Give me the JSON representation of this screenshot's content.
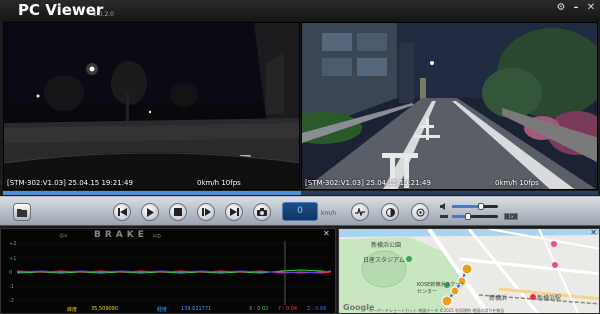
{
  "app": {
    "title": "PC Viewer",
    "version": "2.0.2.0",
    "window_buttons": {
      "settings": "⚙",
      "minimize": "–",
      "close": "✕"
    }
  },
  "video_left": {
    "osd_left": "[STM-302:V1.03] 25.04.15 19:21:49",
    "osd_right": "0km/h  10fps"
  },
  "video_right": {
    "osd_left": "[STM-302:V1.03] 25.04.15 19:21:49",
    "osd_right": "0km/h  10fps"
  },
  "playback": {
    "progress_fraction": 0.5,
    "speed_value": "0",
    "speed_unit": "km/h",
    "volume_fraction": 0.62,
    "balance_fraction": 0.35,
    "mini_label": "1x"
  },
  "graph": {
    "title": "BRAKE",
    "left_arrow": "⇦",
    "right_arrow": "⇨",
    "close": "✕",
    "y_labels": [
      "+2",
      "+1",
      "0",
      "-1",
      "-2"
    ],
    "legend": [
      {
        "text": "緯度",
        "color": "#ffd400"
      },
      {
        "text": "35.509090",
        "color": "#ffd400"
      },
      {
        "text": "経度",
        "color": "#3aa0ff"
      },
      {
        "text": "139.611771",
        "color": "#3aa0ff"
      },
      {
        "text": "X : 0.02",
        "color": "#3cd03c"
      },
      {
        "text": "Y : 0.04",
        "color": "#ff3a3a"
      },
      {
        "text": "Z : 0.86",
        "color": "#3a6aff"
      }
    ]
  },
  "map": {
    "close": "✕",
    "labels": [
      "新横浜公園",
      "日産スタジアム",
      "KOSE新横浜スケートセンター",
      "新横浜",
      "新横浜駅"
    ],
    "attribution": "キーボードショートカット  地図データ ©2025  利用規約  地図の誤りを報告"
  },
  "colors": {
    "accent": "#4f8fd9",
    "graph_bg": "#050505",
    "route": "#2a6df4"
  },
  "icons": [
    "folder-icon",
    "skip-back-icon",
    "play-icon",
    "stop-icon",
    "frame-step-icon",
    "skip-forward-icon",
    "camera-icon",
    "waveform-icon",
    "contrast-icon",
    "crosshair-icon",
    "volume-icon",
    "balance-icon"
  ]
}
